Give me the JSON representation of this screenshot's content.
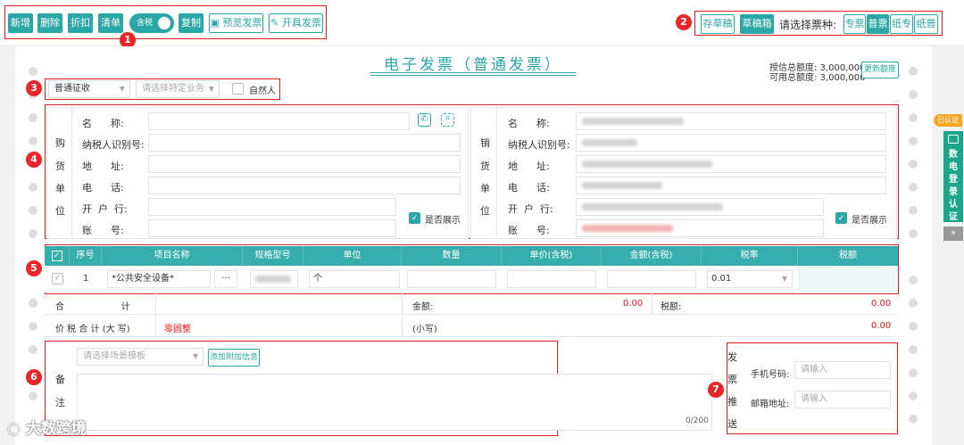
{
  "toolbar": {
    "add": "新增",
    "delete": "删除",
    "discount": "折扣",
    "list": "清单",
    "tax_toggle": "含税",
    "copy": "复制",
    "preview": "预览发票",
    "issue": "开具发票"
  },
  "draft": {
    "save": "存草稿",
    "pick": "草稿箱"
  },
  "ticket_type": {
    "label": "请选择票种:",
    "options": [
      "专票",
      "普票",
      "纸专",
      "纸普"
    ],
    "selected": "普票"
  },
  "badges": [
    "1",
    "2",
    "3",
    "4",
    "5",
    "6",
    "7"
  ],
  "invoice": {
    "title": "电子发票（普通发票）",
    "credit_total": "授信总额度: 3,000,000",
    "available_total": "可用总额度: 3,000,000",
    "update_btn": "更新额度"
  },
  "options_row": {
    "levy": "普通征收",
    "business_placeholder": "请选择特定业务",
    "natural_person": "自然人"
  },
  "buyer": {
    "vertical": [
      "购",
      "货",
      "单",
      "位"
    ],
    "fields": [
      "名      称:",
      "纳税人识别号:",
      "地      址:",
      "电      话:",
      "开  户  行:",
      "账      号:"
    ],
    "show_label": "是否展示"
  },
  "seller": {
    "vertical": [
      "销",
      "货",
      "单",
      "位"
    ],
    "fields": [
      "名      称:",
      "纳税人识别号:",
      "地      址:",
      "电      话:",
      "开  户  行:",
      "账      号:"
    ],
    "show_label": "是否展示"
  },
  "items_table": {
    "headers": [
      "序号",
      "项目名称",
      "规格型号",
      "单位",
      "数量",
      "单价(含税)",
      "金额(含税)",
      "税率",
      "税额"
    ],
    "row": {
      "index": "1",
      "name": "*公共安全设备*",
      "more": "···",
      "unit": "个",
      "tax_rate": "0.01"
    }
  },
  "totals": {
    "sum_label": "合                    计",
    "amount_label": "金额:",
    "amount_value": "0.00",
    "tax_label": "税额:",
    "tax_value": "0.00",
    "grand_label": "价 税 合 计 (大 写)",
    "grand_upper": "零圆整",
    "small_label": "(小写)",
    "small_value": "0.00"
  },
  "remarks": {
    "label_chars": [
      "备",
      "注"
    ],
    "template_placeholder": "请选择场景模板",
    "add_extra": "添加附加信息",
    "counter": "0/200"
  },
  "delivery": {
    "vertical": [
      "发",
      "票",
      "推",
      "送"
    ],
    "phone_label": "手机号码:",
    "phone_placeholder": "请输入",
    "email_label": "邮箱地址:",
    "email_placeholder": "请输入"
  },
  "sidebar": {
    "tag": "已认证",
    "tab": [
      "数",
      "电",
      "登",
      "录",
      "认",
      "证"
    ],
    "expand": "»"
  },
  "watermark": "大数跨境",
  "colors": {
    "teal": "#2aa6a6",
    "header_teal": "#37aeae",
    "annotation_red": "#e02020"
  }
}
